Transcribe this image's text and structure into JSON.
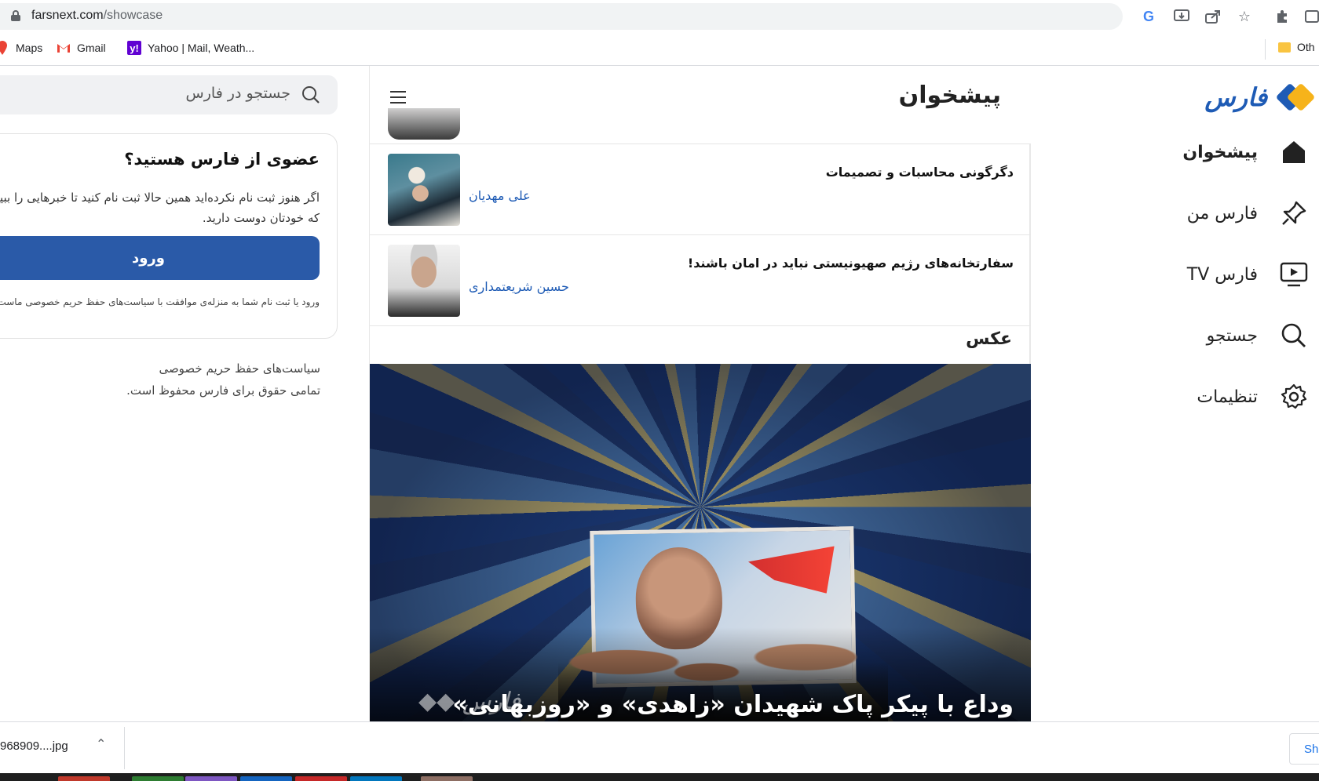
{
  "browser": {
    "url_domain": "farsnext.com",
    "url_path": "/showcase",
    "bookmarks": [
      {
        "label": "Maps",
        "icon": "maps-pin-icon"
      },
      {
        "label": "Gmail",
        "icon": "gmail-icon"
      },
      {
        "label": "Yahoo | Mail, Weath...",
        "icon": "yahoo-icon"
      }
    ],
    "other_bookmarks": "Oth",
    "toolbar_icons": [
      "google-icon",
      "install-app-icon",
      "share-icon",
      "star-icon",
      "extensions-icon",
      "side-panel-icon"
    ]
  },
  "nav": {
    "logo_text": "فارس",
    "items": [
      {
        "label": "پیشخوان",
        "icon": "home-icon",
        "active": true
      },
      {
        "label": "فارس من",
        "icon": "pin-icon",
        "active": false
      },
      {
        "label": "فارس TV",
        "icon": "tv-play-icon",
        "active": false
      },
      {
        "label": "جستجو",
        "icon": "search-icon",
        "active": false
      },
      {
        "label": "تنظیمات",
        "icon": "gear-icon",
        "active": false
      }
    ]
  },
  "feed": {
    "title": "پیشخوان",
    "articles": [
      {
        "title": "دگرگونی محاسبات و تصمیمات",
        "author": "علی مهدیان"
      },
      {
        "title": "سفارتخانه‌های رژیم صهیونیستی نباید در امان باشند!",
        "author": "حسین شریعتمداری"
      }
    ],
    "section_title": "عکس",
    "hero_caption": "وداع با پیکر پاک شهیدان «زاهدی» و «روزبهانی»"
  },
  "sidebar": {
    "search_placeholder": "جستجو در فارس",
    "card_title": "عضوی از فارس هستید؟",
    "card_text": "اگر هنوز ثبت نام نکرده‌اید همین حالا ثبت نام کنید تا خبرهایی را ببینید که خودتان دوست دارید.",
    "login_label": "ورود",
    "card_note": "ورود یا ثبت نام شما به منزله‌ی موافقت با سیاست‌های حفظ حریم خصوصی ماست.",
    "privacy_link": "سیاست‌های حفظ حریم خصوصی",
    "copyright": "تمامی حقوق برای فارس محفوظ است."
  },
  "downloads": {
    "file_name": "968909....jpg",
    "show_all": "Sh"
  }
}
